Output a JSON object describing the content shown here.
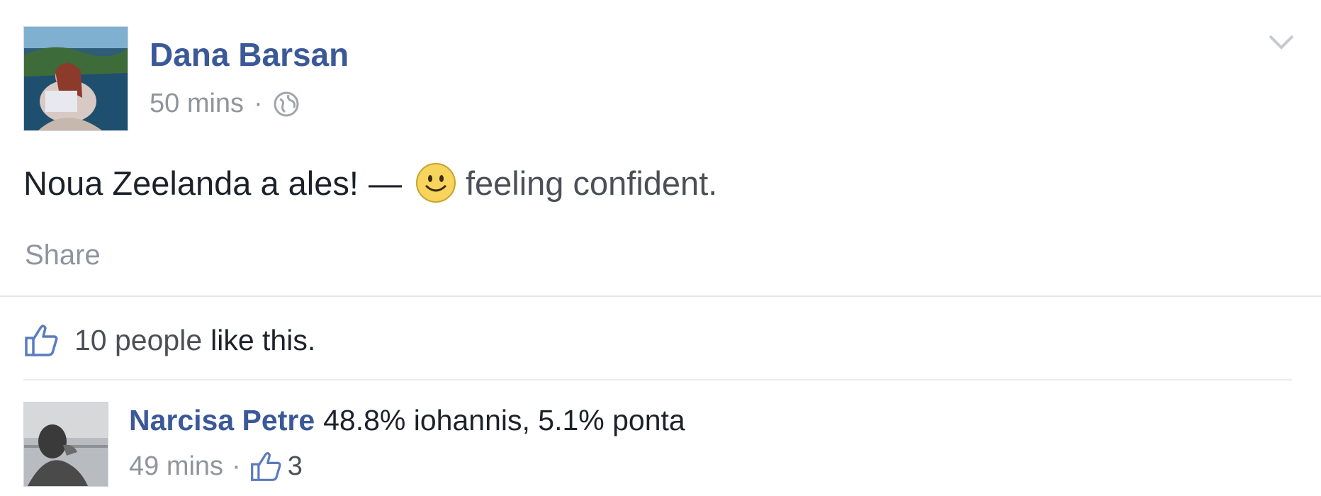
{
  "post": {
    "author": "Dana Barsan",
    "time": "50 mins",
    "separator": "·",
    "text": "Noua Zeelanda a ales!",
    "dash": "—",
    "feeling_icon": "smiley-icon",
    "feeling": "feeling confident.",
    "share_label": "Share",
    "audience_icon": "globe-icon"
  },
  "likes": {
    "people": "10 people",
    "suffix": "like this."
  },
  "comment": {
    "author": "Narcisa Petre",
    "text": "48.8% iohannis, 5.1% ponta",
    "time": "49 mins",
    "separator": "·",
    "like_count": "3"
  },
  "colors": {
    "link": "#3b5998",
    "muted": "#90949c",
    "text": "#1d2129"
  }
}
